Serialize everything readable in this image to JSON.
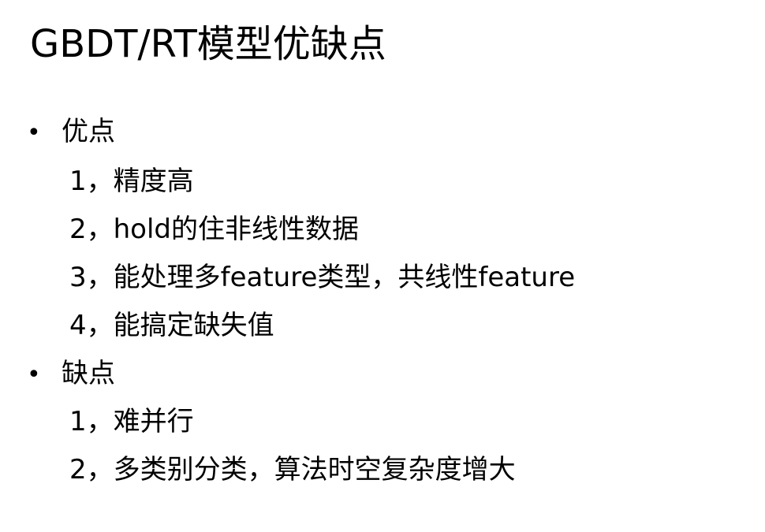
{
  "slide": {
    "title": "GBDT/RT模型优缺点",
    "sections": [
      {
        "bullet": "•",
        "heading": "优点",
        "items": [
          "1，精度高",
          "2，hold的住非线性数据",
          "3，能处理多feature类型，共线性feature",
          "4，能搞定缺失值"
        ]
      },
      {
        "bullet": "•",
        "heading": "缺点",
        "items": [
          "1，难并行",
          "2，多类别分类，算法时空复杂度增大"
        ]
      }
    ]
  }
}
